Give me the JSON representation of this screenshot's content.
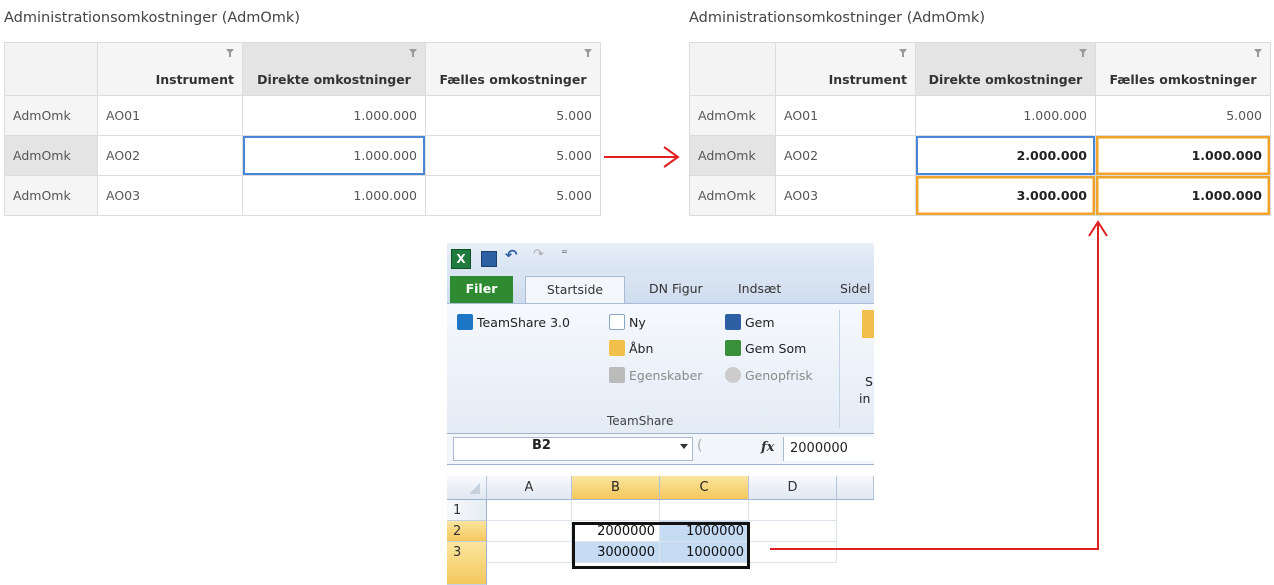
{
  "before_panel": {
    "title": "Administrationsomkostninger (AdmOmk)",
    "headers": [
      "Instrument",
      "Direkte omkostninger",
      "Fælles omkostninger"
    ],
    "rows": [
      {
        "label": "AdmOmk",
        "instrument": "AO01",
        "direkte": "1.000.000",
        "faelles": "5.000"
      },
      {
        "label": "AdmOmk",
        "instrument": "AO02",
        "direkte": "1.000.000",
        "faelles": "5.000"
      },
      {
        "label": "AdmOmk",
        "instrument": "AO03",
        "direkte": "1.000.000",
        "faelles": "5.000"
      }
    ]
  },
  "after_panel": {
    "title": "Administrationsomkostninger (AdmOmk)",
    "headers": [
      "Instrument",
      "Direkte omkostninger",
      "Fælles omkostninger"
    ],
    "rows": [
      {
        "label": "AdmOmk",
        "instrument": "AO01",
        "direkte": "1.000.000",
        "faelles": "5.000"
      },
      {
        "label": "AdmOmk",
        "instrument": "AO02",
        "direkte": "2.000.000",
        "faelles": "1.000.000"
      },
      {
        "label": "AdmOmk",
        "instrument": "AO03",
        "direkte": "3.000.000",
        "faelles": "1.000.000"
      }
    ]
  },
  "excel": {
    "tabs": {
      "filer": "Filer",
      "startside": "Startside",
      "dn_figur": "DN Figur",
      "indsaet": "Indsæt",
      "side": "Sidel"
    },
    "ribbon": {
      "teamshare": "TeamShare 3.0",
      "ny": "Ny",
      "gem": "Gem",
      "aabn": "Åbn",
      "gem_som": "Gem Som",
      "egenskaber": "Egenskaber",
      "genopfrisk": "Genopfrisk",
      "group_label": "TeamShare",
      "cut_s": "S",
      "cut_in": "in"
    },
    "name_box": "B2",
    "fx_label": "fx",
    "formula_value": "2000000",
    "columns": [
      "A",
      "B",
      "C",
      "D"
    ],
    "rows": [
      {
        "num": "1",
        "b": "",
        "c": ""
      },
      {
        "num": "2",
        "b": "2000000",
        "c": "1000000"
      },
      {
        "num": "3",
        "b": "3000000",
        "c": "1000000"
      }
    ]
  },
  "colors": {
    "arrow": "#e02020",
    "blue_selection": "#4a86d8",
    "orange_changed": "#f0a52a",
    "excel_file_tab": "#2e8b32"
  }
}
